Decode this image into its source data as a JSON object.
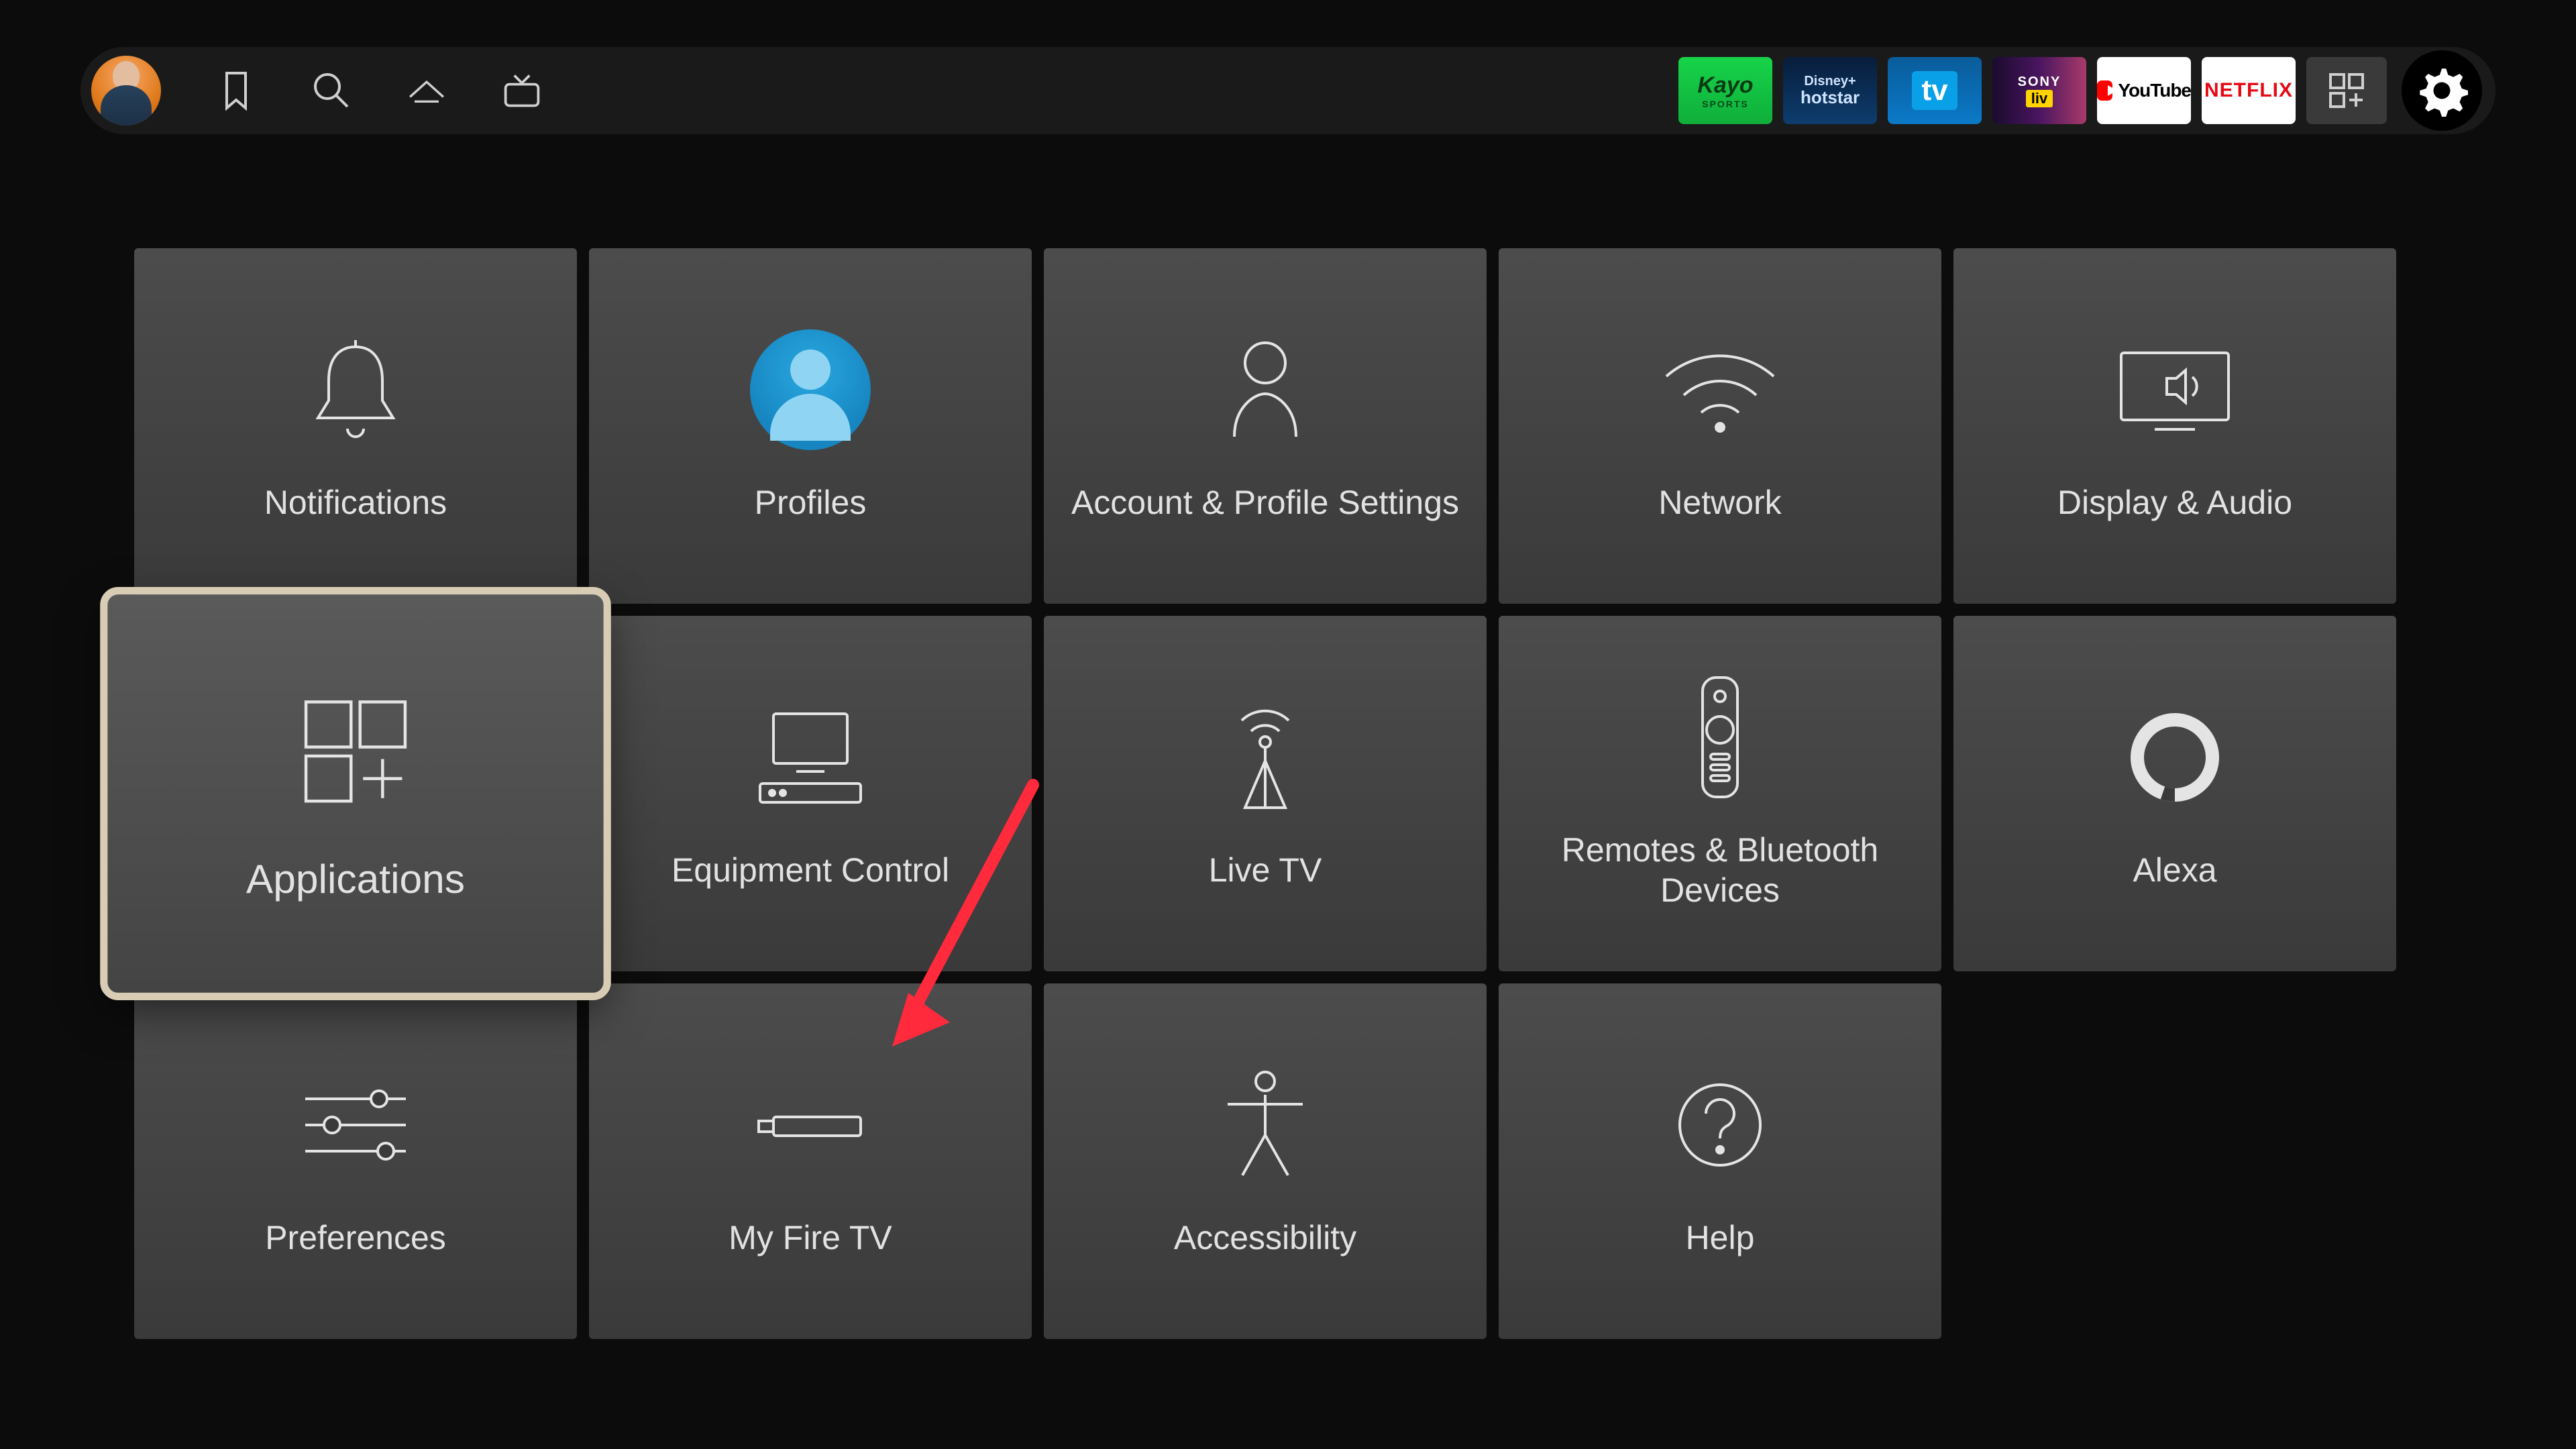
{
  "topbar": {
    "apps": {
      "kayo": {
        "line1": "Kayo",
        "line2": "SPORTS"
      },
      "hotstar": {
        "line1": "Disney+",
        "line2": "hotstar"
      },
      "tv": "tv",
      "sony": {
        "line1": "SONY",
        "line2": "liv"
      },
      "youtube": "YouTube",
      "netflix": "NETFLIX"
    }
  },
  "settings": {
    "notifications": "Notifications",
    "profiles": "Profiles",
    "account": "Account & Profile Settings",
    "network": "Network",
    "display_audio": "Display & Audio",
    "applications": "Applications",
    "equipment": "Equipment Control",
    "live_tv": "Live TV",
    "remotes": "Remotes & Bluetooth Devices",
    "alexa": "Alexa",
    "preferences": "Preferences",
    "my_fire_tv": "My Fire TV",
    "accessibility": "Accessibility",
    "help": "Help"
  },
  "selected_tile": "applications",
  "arrow_target": "my_fire_tv"
}
